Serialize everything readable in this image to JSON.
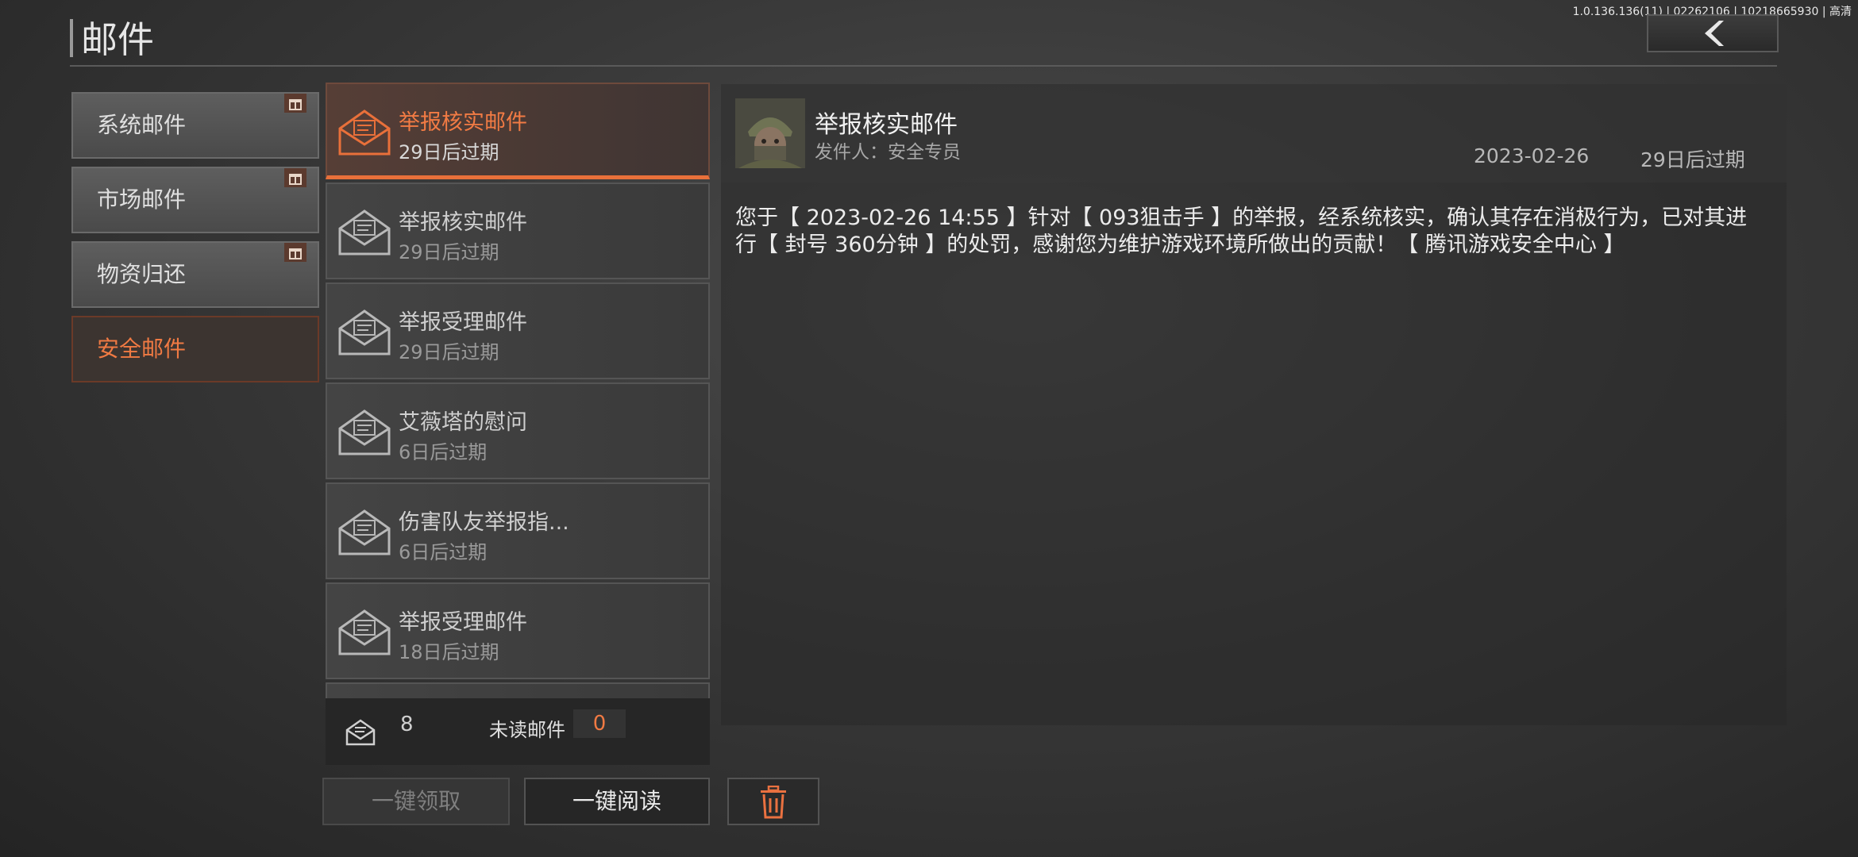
{
  "version": "1.0.136.136(11) | 02262106 | 10218665930 | 高清",
  "page": {
    "title": "邮件"
  },
  "categories": [
    {
      "label": "系统邮件",
      "has_gift": true
    },
    {
      "label": "市场邮件",
      "has_gift": true
    },
    {
      "label": "物资归还",
      "has_gift": true
    },
    {
      "label": "安全邮件",
      "has_gift": false,
      "active": true
    }
  ],
  "mails": [
    {
      "title": "举报核实邮件",
      "expiry": "29日后过期",
      "active": true
    },
    {
      "title": "举报核实邮件",
      "expiry": "29日后过期"
    },
    {
      "title": "举报受理邮件",
      "expiry": "29日后过期"
    },
    {
      "title": "艾薇塔的慰问",
      "expiry": "6日后过期"
    },
    {
      "title": "伤害队友举报指...",
      "expiry": "6日后过期"
    },
    {
      "title": "举报受理邮件",
      "expiry": "18日后过期"
    }
  ],
  "footer": {
    "count": "8",
    "unread_label": "未读邮件",
    "unread_count": "0"
  },
  "buttons": {
    "claim_all": "一键领取",
    "read_all": "一键阅读"
  },
  "detail": {
    "title": "举报核实邮件",
    "sender": "发件人：安全专员",
    "date": "2023-02-26",
    "expiry": "29日后过期",
    "body": "您于【 2023-02-26 14:55 】针对【 093狙击手 】的举报，经系统核实，确认其存在消极行为，已对其进行【 封号 360分钟 】的处罚，感谢您为维护游戏环境所做出的贡献！【 腾讯游戏安全中心 】"
  },
  "colors": {
    "accent": "#f07a43",
    "active_border": "#e9703a"
  },
  "icons": {
    "back": "chevron-left-icon",
    "gift": "gift-icon",
    "mail": "envelope-open-icon",
    "delete": "trash-icon"
  }
}
